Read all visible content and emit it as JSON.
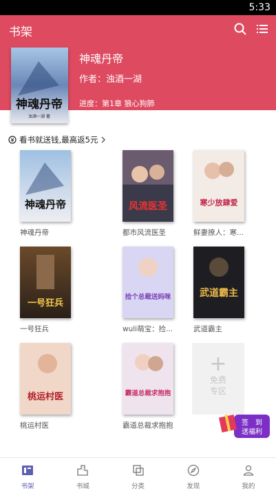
{
  "status": {
    "time": "5:33"
  },
  "appbar": {
    "title": "书架"
  },
  "hero": {
    "name": "神魂丹帝",
    "author": "作者：浊酒一湖",
    "progress": "进度：第1章 狼心狗肺",
    "cover_title": "神魂丹帝",
    "cover_sub": "浊酒一湖 著"
  },
  "promo": {
    "text": "看书就送钱,最高返5元"
  },
  "books": [
    {
      "label": "神魂丹帝",
      "cover_text": "神魂丹帝"
    },
    {
      "label": "都市风流医圣",
      "cover_text": "风流医圣"
    },
    {
      "label": "鲜妻撩人：寒...",
      "cover_text": "寒少放肆爱"
    },
    {
      "label": "一号狂兵",
      "cover_text": "一号狂兵"
    },
    {
      "label": "wuli萌宝：捡...",
      "cover_text": "捡个总裁送妈咪"
    },
    {
      "label": "武道霸主",
      "cover_text": "武道霸主"
    },
    {
      "label": "桃运村医",
      "cover_text": "桃运村医"
    },
    {
      "label": "霸道总裁求抱抱",
      "cover_text": "霸道总裁求抱抱"
    }
  ],
  "free_zone": {
    "line1": "免费",
    "line2": "专区"
  },
  "gift": {
    "line1": "签　到",
    "line2": "送福利"
  },
  "tabs": [
    {
      "label": "书架",
      "icon": "bookshelf-icon",
      "active": true
    },
    {
      "label": "书城",
      "icon": "city-icon"
    },
    {
      "label": "分类",
      "icon": "category-icon"
    },
    {
      "label": "发现",
      "icon": "compass-icon"
    },
    {
      "label": "我的",
      "icon": "person-icon"
    }
  ],
  "colors": {
    "accent": "#de4a60",
    "tab_active": "#5e5fb3"
  }
}
